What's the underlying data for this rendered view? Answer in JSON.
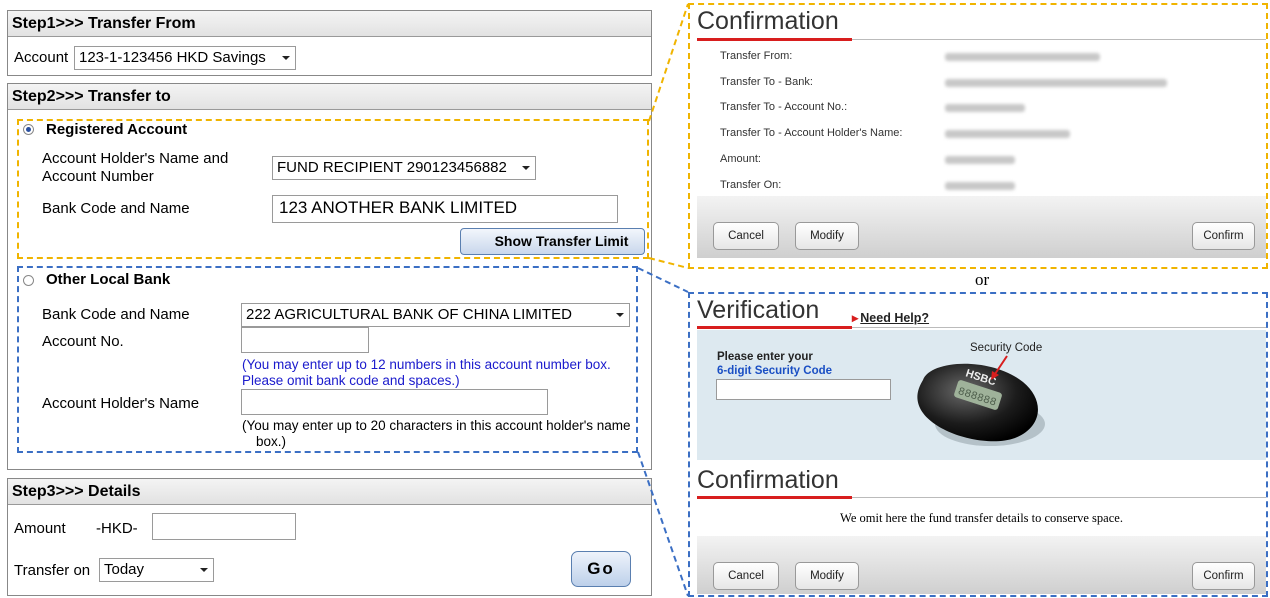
{
  "step1": {
    "header": "Step1>>> Transfer From",
    "account_label": "Account",
    "account_value": "123-1-123456 HKD Savings"
  },
  "step2": {
    "header": "Step2>>> Transfer to",
    "registered": {
      "title": "Registered Account",
      "selected": true,
      "holder_label_line1": "Account Holder's Name and",
      "holder_label_line2": "Account Number",
      "holder_value": "FUND RECIPIENT 290123456882",
      "bank_label": "Bank Code and Name",
      "bank_value": "123 ANOTHER BANK LIMITED",
      "limit_button": "Show Transfer Limit"
    },
    "other": {
      "title": "Other Local Bank",
      "selected": false,
      "bank_label": "Bank Code and Name",
      "bank_value": "222 AGRICULTURAL BANK OF CHINA LIMITED",
      "account_label": "Account No.",
      "account_hint_line1": "(You may enter up to 12 numbers in this account number box.",
      "account_hint_line2": "Please omit bank code and spaces.)",
      "holder_label": "Account Holder's Name",
      "holder_hint_line1": "(You may enter up to 20 characters in this account holder's name",
      "holder_hint_line2": "box.)"
    }
  },
  "step3": {
    "header": "Step3>>> Details",
    "amount_label": "Amount",
    "currency": "-HKD-",
    "transfer_on_label": "Transfer on",
    "transfer_on_value": "Today",
    "go_button": "Go"
  },
  "confirmation_top": {
    "title": "Confirmation",
    "rows": [
      "Transfer From:",
      "Transfer To - Bank:",
      "Transfer To - Account No.:",
      "Transfer To - Account Holder's Name:",
      "Amount:",
      "Transfer On:"
    ],
    "cancel": "Cancel",
    "modify": "Modify",
    "confirm": "Confirm"
  },
  "or_text": "or",
  "verification": {
    "title": "Verification",
    "need_help": "Need Help?",
    "prompt_line1": "Please enter your",
    "prompt_line2": "6-digit Security Code",
    "security_code_label": "Security Code",
    "device_brand": "HSBC",
    "device_display": "888888"
  },
  "confirmation_bottom": {
    "title": "Confirmation",
    "note": "We omit here the fund transfer details to conserve space.",
    "cancel": "Cancel",
    "modify": "Modify",
    "confirm": "Confirm"
  },
  "colors": {
    "highlight_yellow": "#f0b400",
    "highlight_blue": "#3b6fc4",
    "accent_red": "#d81e1e",
    "verify_bg": "#dde9f0"
  }
}
